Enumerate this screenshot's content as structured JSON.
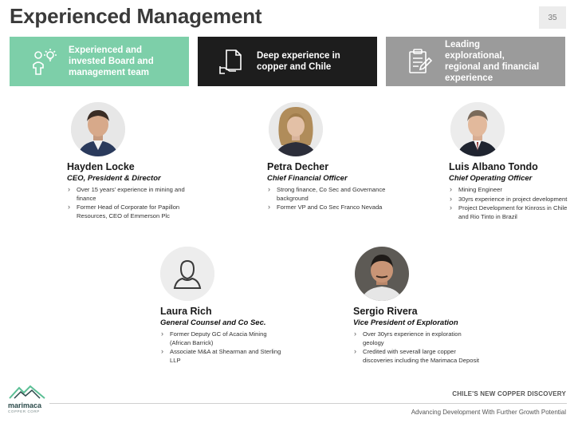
{
  "header": {
    "title": "Experienced Management",
    "page_number": "35"
  },
  "banners": [
    {
      "icon": "person-idea-icon",
      "label": "Experienced and invested Board and management team",
      "color": "#7dcfa9"
    },
    {
      "icon": "document-hand-icon",
      "label": "Deep experience in copper and Chile",
      "color": "#1d1d1d"
    },
    {
      "icon": "clipboard-pen-icon",
      "label": "Leading explorational, regional and financial experience",
      "color": "#9b9b9b"
    }
  ],
  "people": [
    {
      "name": "Hayden Locke",
      "role": "CEO, President & Director",
      "bullets": [
        "Over 15 years' experience in mining and finance",
        "Former Head of Corporate for Papillon Resources, CEO of Emmerson Plc"
      ]
    },
    {
      "name": "Petra Decher",
      "role": "Chief Financial Officer",
      "bullets": [
        "Strong finance, Co Sec and Governance background",
        "Former VP and Co Sec Franco Nevada"
      ]
    },
    {
      "name": "Luis Albano Tondo",
      "role": "Chief Operating Officer",
      "bullets": [
        "Mining Engineer",
        "30yrs experience in project development",
        "Project Development for Kinross in Chile and Rio Tinto in Brazil"
      ]
    },
    {
      "name": "Laura Rich",
      "role": "General Counsel and Co Sec.",
      "bullets": [
        "Former Deputy GC of Acacia Mining (African Barrick)",
        "Associate M&A at Shearman and Sterling LLP"
      ]
    },
    {
      "name": "Sergio Rivera",
      "role": "Vice President of Exploration",
      "bullets": [
        "Over 30yrs experience in exploration geology",
        "Credited with severall large copper discoveries including the Marimaca Deposit"
      ]
    }
  ],
  "footer": {
    "tagline": "CHILE'S NEW COPPER DISCOVERY",
    "subtitle": "Advancing Development With Further Growth Potential",
    "logo_text": "marimaca",
    "logo_sub": "COPPER CORP"
  }
}
